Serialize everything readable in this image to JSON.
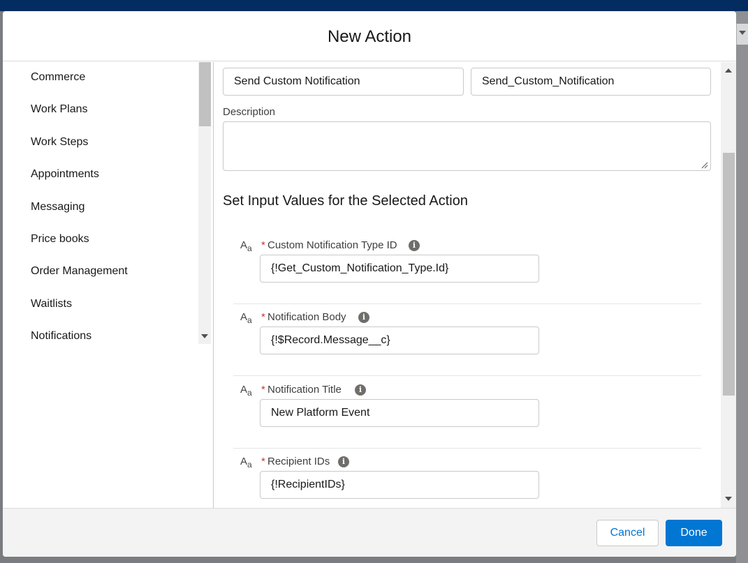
{
  "modal": {
    "title": "New Action"
  },
  "sidebar": {
    "items": [
      {
        "label": "Commerce"
      },
      {
        "label": "Work Plans"
      },
      {
        "label": "Work Steps"
      },
      {
        "label": "Appointments"
      },
      {
        "label": "Messaging"
      },
      {
        "label": "Price books"
      },
      {
        "label": "Order Management"
      },
      {
        "label": "Waitlists"
      },
      {
        "label": "Notifications"
      }
    ]
  },
  "form": {
    "label_value": "Send Custom Notification",
    "api_name_value": "Send_Custom_Notification",
    "description_label": "Description",
    "description_value": "",
    "section_title": "Set Input Values for the Selected Action",
    "params": [
      {
        "label": "Custom Notification Type ID",
        "value": "{!Get_Custom_Notification_Type.Id}",
        "required": "*",
        "type_icon": "text-type-icon"
      },
      {
        "label": "Notification Body",
        "value": "{!$Record.Message__c}",
        "required": "*",
        "type_icon": "text-type-icon"
      },
      {
        "label": "Notification Title",
        "value": "New Platform Event",
        "required": "*",
        "type_icon": "text-type-icon"
      },
      {
        "label": "Recipient IDs",
        "value": "{!RecipientIDs}",
        "required": "*",
        "type_icon": "text-type-icon"
      }
    ]
  },
  "footer": {
    "cancel_label": "Cancel",
    "done_label": "Done"
  },
  "colors": {
    "brand": "#0176d3",
    "header_bar": "#032d60",
    "required": "#c23934"
  },
  "icons": {
    "type": "Aa",
    "info": "i"
  }
}
